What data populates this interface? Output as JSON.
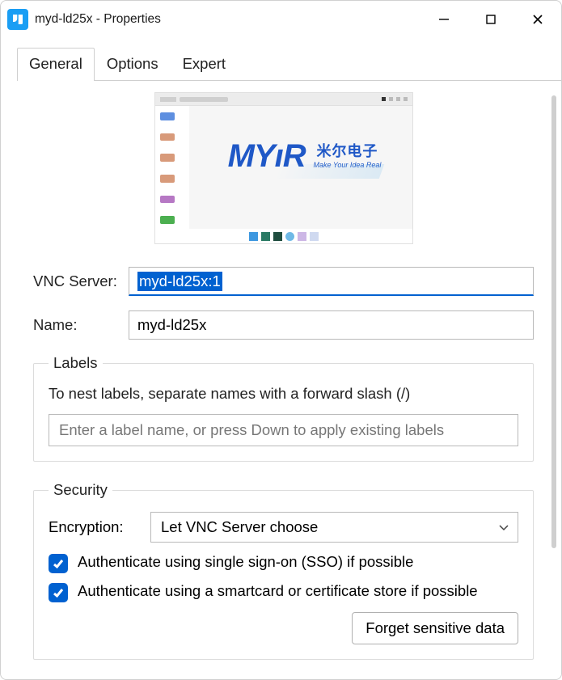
{
  "window": {
    "title": "myd-ld25x - Properties"
  },
  "tabs": [
    {
      "label": "General"
    },
    {
      "label": "Options"
    },
    {
      "label": "Expert"
    }
  ],
  "preview": {
    "logo_main": "MYıR",
    "logo_cjk": "米尔电子",
    "logo_tagline": "Make Your Idea Real"
  },
  "fields": {
    "vnc_server_label": "VNC Server:",
    "vnc_server_value": "myd-ld25x:1",
    "name_label": "Name:",
    "name_value": "myd-ld25x"
  },
  "labels_group": {
    "legend": "Labels",
    "hint": "To nest labels, separate names with a forward slash (/)",
    "placeholder": "Enter a label name, or press Down to apply existing labels"
  },
  "security_group": {
    "legend": "Security",
    "encryption_label": "Encryption:",
    "encryption_value": "Let VNC Server choose",
    "check_sso": "Authenticate using single sign-on (SSO) if possible",
    "check_smartcard": "Authenticate using a smartcard or certificate store if possible",
    "forget_button": "Forget sensitive data"
  }
}
